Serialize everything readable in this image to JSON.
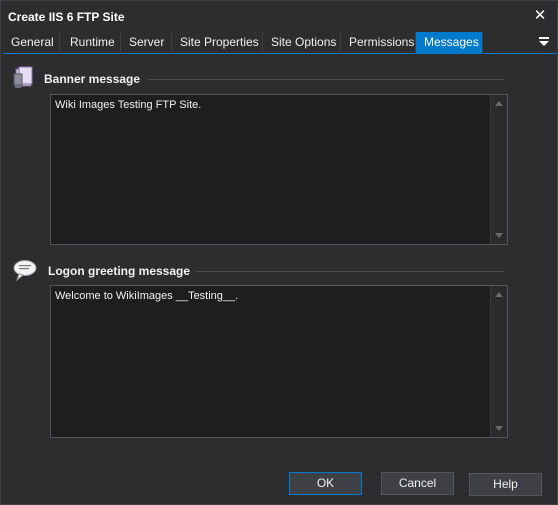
{
  "window": {
    "title": "Create IIS 6 FTP Site",
    "close_glyph": "✕"
  },
  "tabs": [
    {
      "label": "General",
      "active": false
    },
    {
      "label": "Runtime",
      "active": false
    },
    {
      "label": "Server",
      "active": false
    },
    {
      "label": "Site Properties",
      "active": false
    },
    {
      "label": "Site Options",
      "active": false
    },
    {
      "label": "Permissions",
      "active": false
    },
    {
      "label": "Messages",
      "active": true
    }
  ],
  "banner": {
    "label": "Banner message",
    "icon": "banner-book-icon",
    "value": "Wiki Images Testing FTP Site."
  },
  "logon": {
    "label": "Logon greeting message",
    "icon": "speech-bubble-icon",
    "value": "Welcome to WikiImages __Testing__."
  },
  "buttons": {
    "ok": "OK",
    "cancel": "Cancel",
    "help": "Help"
  },
  "colors": {
    "accent": "#007acc",
    "background": "#2d2d30",
    "field": "#1e1e1e"
  }
}
